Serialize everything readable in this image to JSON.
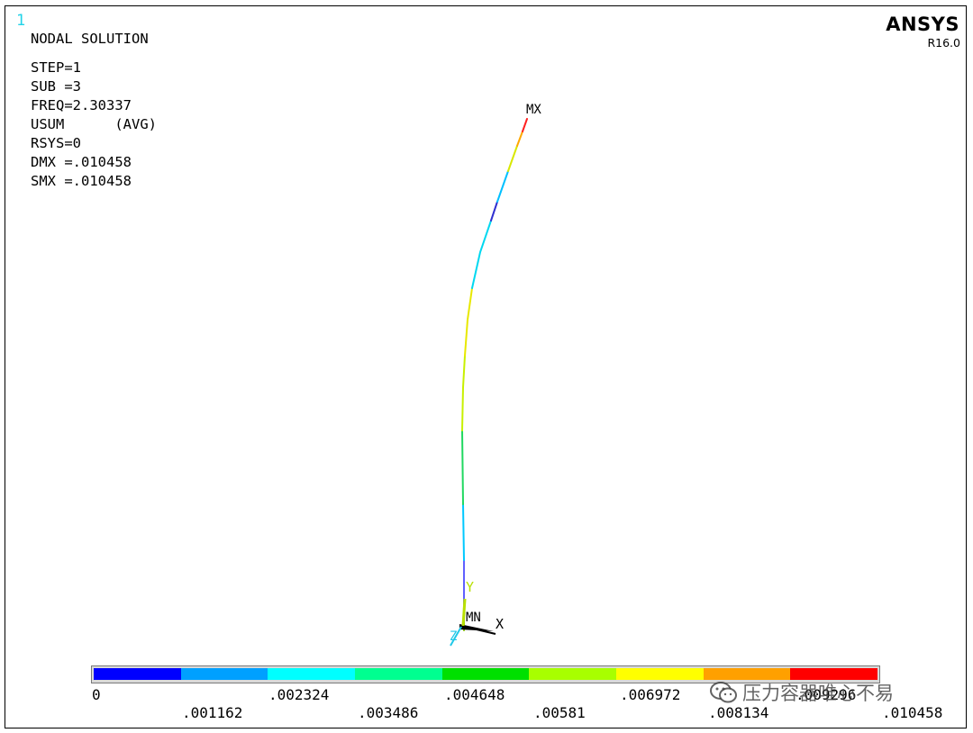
{
  "window": {
    "number": "1"
  },
  "header": {
    "solution_title": "NODAL SOLUTION",
    "info_lines": [
      "STEP=1",
      "SUB =3",
      "FREQ=2.30337",
      "USUM      (AVG)",
      "RSYS=0",
      "DMX =.010458",
      "SMX =.010458"
    ]
  },
  "branding": {
    "logo": "ANSYS",
    "version": "R16.0"
  },
  "plot_labels": {
    "max_label": "MX",
    "min_label": "MN"
  },
  "triad": {
    "x_label": "X",
    "y_label": "Y",
    "z_label": "Z"
  },
  "legend": {
    "colors": [
      "#0000ff",
      "#00a0ff",
      "#00ffff",
      "#00ff90",
      "#00e000",
      "#a8ff00",
      "#ffff00",
      "#ffa000",
      "#ff0000"
    ],
    "labels_top": [
      "0",
      ".002324",
      ".004648",
      ".006972",
      ".009296"
    ],
    "labels_bottom": [
      ".001162",
      ".003486",
      ".00581",
      ".008134",
      ".010458"
    ]
  },
  "watermark": {
    "text": "压力容器唯心不易",
    "icon": "wechat-icon"
  }
}
